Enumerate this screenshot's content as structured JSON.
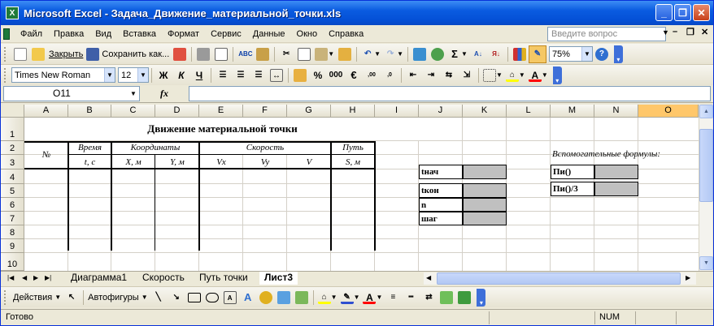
{
  "window": {
    "title": "Microsoft Excel - Задача_Движение_материальной_точки.xls",
    "app_letter": "X"
  },
  "menu": [
    "Файл",
    "Правка",
    "Вид",
    "Вставка",
    "Формат",
    "Сервис",
    "Данные",
    "Окно",
    "Справка"
  ],
  "help": {
    "placeholder": "Введите вопрос"
  },
  "toolbar": {
    "close_label": "Закрыть",
    "save_as_label": "Сохранить как...",
    "zoom": "75%"
  },
  "format": {
    "font": "Times New Roman",
    "size": "12",
    "bold": "Ж",
    "italic": "К",
    "underline": "Ч",
    "percent": "%",
    "thousands": "000",
    "euro": "€"
  },
  "namebox": {
    "value": "O11",
    "fx": "fx"
  },
  "columns": [
    "A",
    "B",
    "C",
    "D",
    "E",
    "F",
    "G",
    "H",
    "I",
    "J",
    "K",
    "L",
    "M",
    "N",
    "O"
  ],
  "rows": [
    "1",
    "2",
    "3",
    "4",
    "5",
    "6",
    "7",
    "8",
    "9",
    "10"
  ],
  "sheet": {
    "title": "Движение материальной точки",
    "h_num": "№",
    "h_time": "Время",
    "h_coords": "Координаты",
    "h_speed": "Скорость",
    "h_path": "Путь",
    "u_t": "t, с",
    "u_x": "X, м",
    "u_y": "Y, м",
    "u_vx": "Vx",
    "u_vy": "Vy",
    "u_v": "V",
    "u_s": "S, м",
    "p_tnach": "tнач",
    "p_tkon": "tкон",
    "p_n": "n",
    "p_shag": "шаг",
    "aux_title": "Вспомогательные формулы:",
    "aux_pi": "Пи()",
    "aux_pi3": "Пи()/3"
  },
  "tabs": [
    "Диаграмма1",
    "Скорость",
    "Путь точки",
    "Лист3"
  ],
  "drawing": {
    "actions": "Действия",
    "autoshapes": "Автофигуры"
  },
  "status": {
    "ready": "Готово",
    "num": "NUM"
  }
}
